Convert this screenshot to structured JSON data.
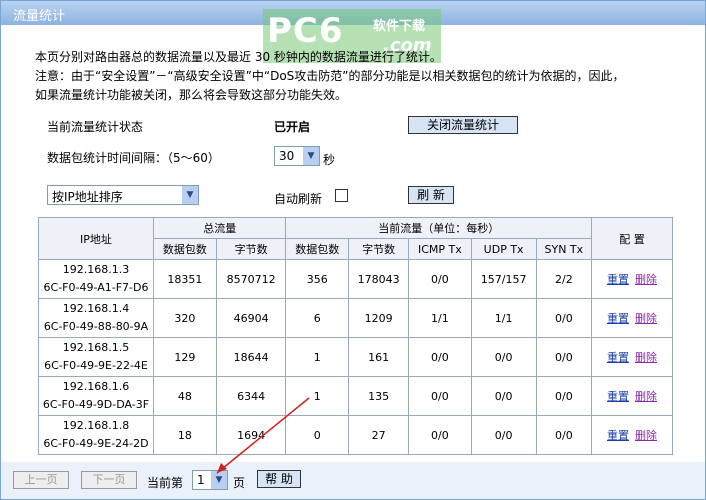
{
  "titlebar": {
    "title": "流量统计"
  },
  "watermark": {
    "main": "PC6",
    "sub": "软件下载",
    "com": ".com"
  },
  "description": {
    "line1": "本页分别对路由器总的数据流量以及最近 30 秒钟内的数据流量进行了统计。",
    "line2": "注意：由于“安全设置”－“高级安全设置”中“DoS攻击防范”的部分功能是以相关数据包的统计为依据的，因此，",
    "line3": "如果流量统计功能被关闭，那么将会导致这部分功能失效。"
  },
  "status": {
    "label": "当前流量统计状态",
    "value": "已开启",
    "toggle_button": "关闭流量统计"
  },
  "interval": {
    "label": "数据包统计时间间隔：（5～60）",
    "value": "30",
    "unit": "秒"
  },
  "sort": {
    "selected": "按IP地址排序"
  },
  "refresh": {
    "auto_label": "自动刷新",
    "auto_checked": false,
    "button": "刷 新"
  },
  "table": {
    "group_total": "总流量",
    "group_current": "当前流量（单位：每秒）",
    "config_header": "配 置",
    "ip_header": "IP地址",
    "headers": [
      "数据包数",
      "字节数",
      "数据包数",
      "字节数",
      "ICMP Tx",
      "UDP Tx",
      "SYN Tx"
    ],
    "reset_label": "重置",
    "delete_label": "删除",
    "rows": [
      {
        "ip": "192.168.1.3",
        "mac": "6C-F0-49-A1-F7-D6",
        "cells": [
          "18351",
          "8570712",
          "356",
          "178043",
          "0/0",
          "157/157",
          "2/2"
        ]
      },
      {
        "ip": "192.168.1.4",
        "mac": "6C-F0-49-88-80-9A",
        "cells": [
          "320",
          "46904",
          "6",
          "1209",
          "1/1",
          "1/1",
          "0/0"
        ]
      },
      {
        "ip": "192.168.1.5",
        "mac": "6C-F0-49-9E-22-4E",
        "cells": [
          "129",
          "18644",
          "1",
          "161",
          "0/0",
          "0/0",
          "0/0"
        ]
      },
      {
        "ip": "192.168.1.6",
        "mac": "6C-F0-49-9D-DA-3F",
        "cells": [
          "48",
          "6344",
          "1",
          "135",
          "0/0",
          "0/0",
          "0/0"
        ]
      },
      {
        "ip": "192.168.1.8",
        "mac": "6C-F0-49-9E-24-2D",
        "cells": [
          "18",
          "1694",
          "0",
          "27",
          "0/0",
          "0/0",
          "0/0"
        ]
      }
    ]
  },
  "pager": {
    "prev": "上一页",
    "next": "下一页",
    "current_label": "当前第",
    "page": "1",
    "page_unit": "页",
    "help": "帮 助"
  },
  "colors": {
    "titlebar": "#8cb3e0",
    "link": "#1a3fa6",
    "link_visited": "#8a2aa6",
    "arrow": "#d02020"
  }
}
